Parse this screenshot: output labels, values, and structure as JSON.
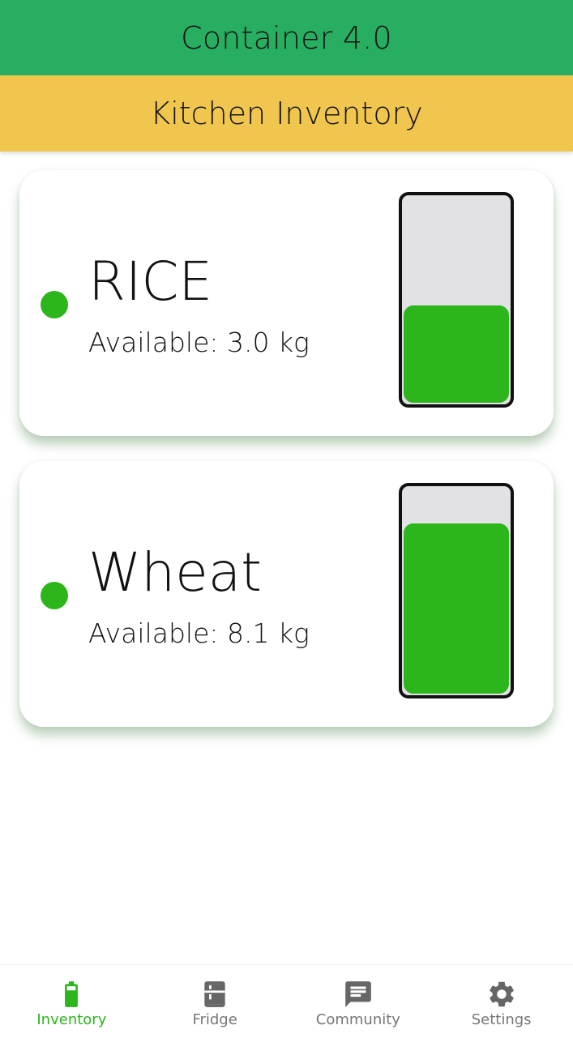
{
  "appbar": {
    "title": "Container 4.0",
    "color": "#27ae60"
  },
  "subbar": {
    "title": "Kitchen Inventory",
    "color": "#f1c64e"
  },
  "items": [
    {
      "name": "RICE",
      "available": "Available: 3.0 kg",
      "fill_fraction": 0.48,
      "status_color": "#2db51c",
      "fill_color": "#2db51c"
    },
    {
      "name": "Wheat",
      "available": "Available: 8.1 kg",
      "fill_fraction": 0.83,
      "status_color": "#2db51c",
      "fill_color": "#2db51c"
    }
  ],
  "nav": {
    "active_color": "#2db51c",
    "inactive_color": "#666666",
    "items": [
      {
        "label": "Inventory",
        "icon": "battery-icon",
        "active": true
      },
      {
        "label": "Fridge",
        "icon": "fridge-icon",
        "active": false
      },
      {
        "label": "Community",
        "icon": "chat-icon",
        "active": false
      },
      {
        "label": "Settings",
        "icon": "gear-icon",
        "active": false
      }
    ]
  }
}
